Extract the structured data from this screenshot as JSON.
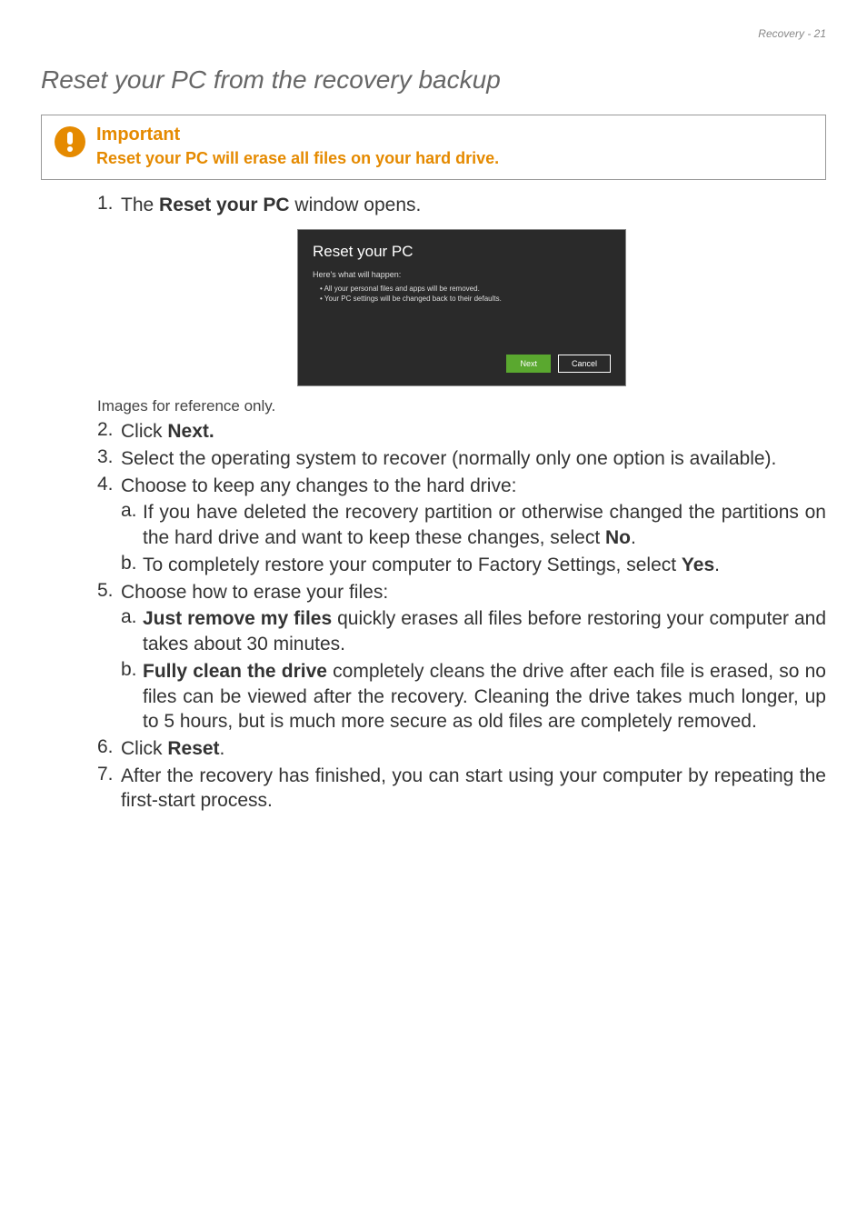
{
  "header": {
    "breadcrumb": "Recovery - 21"
  },
  "section_title": "Reset your PC from the recovery backup",
  "callout": {
    "title_label": "Important",
    "body_text": "Reset your PC will erase all files on your hard drive."
  },
  "shot": {
    "title": "Reset your PC",
    "subtitle": "Here's what will happen:",
    "bullets": [
      "All your personal files and apps will be removed.",
      "Your PC settings will be changed back to their defaults."
    ],
    "next_label": "Next",
    "cancel_label": "Cancel"
  },
  "caption": "Images for reference only.",
  "steps": {
    "s1_pre": "The ",
    "s1_bold": "Reset your PC",
    "s1_post": " window opens.",
    "s2_pre": "Click ",
    "s2_bold": "Next.",
    "s3": "Select the operating system to recover (normally only one option is available).",
    "s4": "Choose to keep any changes to the hard drive:",
    "s4a_pre": "If you have deleted the recovery partition or otherwise changed the partitions on the hard drive and want to keep these changes, select ",
    "s4a_bold": "No",
    "s4a_post": ".",
    "s4b_pre": "To completely restore your computer to Factory Settings, select ",
    "s4b_bold": "Yes",
    "s4b_post": ".",
    "s5": "Choose how to erase your files:",
    "s5a_bold": "Just remove my files",
    "s5a_post": " quickly erases all files before restoring your computer and takes about 30 minutes.",
    "s5b_bold": "Fully clean the drive",
    "s5b_post": " completely cleans the drive after each file is erased, so no files can be viewed after the recovery. Cleaning the drive takes much longer, up to 5 hours, but is much more secure as old files are completely removed.",
    "s6_pre": "Click ",
    "s6_bold": "Reset",
    "s6_post": ".",
    "s7": "After the recovery has finished, you can start using your computer by repeating the first-start process."
  },
  "nums": {
    "n1": "1.",
    "n2": "2.",
    "n3": "3.",
    "n4": "4.",
    "n5": "5.",
    "n6": "6.",
    "n7": "7.",
    "a": "a.",
    "b": "b."
  }
}
